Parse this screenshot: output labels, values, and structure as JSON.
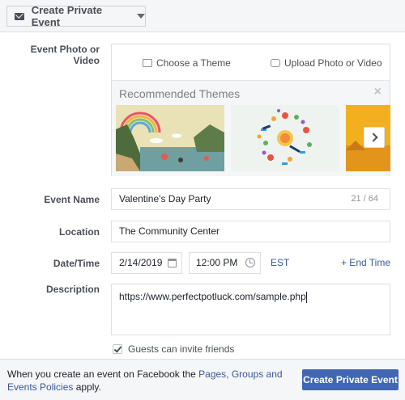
{
  "header": {
    "event_type": "Create Private Event"
  },
  "photo": {
    "label": "Event Photo or Video",
    "choose_theme": "Choose a Theme",
    "upload": "Upload Photo or Video",
    "recommended_title": "Recommended Themes",
    "close_glyph": "×"
  },
  "event_name": {
    "label": "Event Name",
    "value": "Valentine's Day Party",
    "counter": "21 / 64"
  },
  "location": {
    "label": "Location",
    "value": "The Community Center"
  },
  "datetime": {
    "label": "Date/Time",
    "date": "2/14/2019",
    "time": "12:00 PM",
    "timezone": "EST",
    "end_time": "+ End Time"
  },
  "description": {
    "label": "Description",
    "value": "https://www.perfectpotluck.com/sample.php"
  },
  "guests": {
    "label": "Guests can invite friends",
    "checked": true
  },
  "footer": {
    "text_before": "When you create an event on Facebook the ",
    "policy_link": "Pages, Groups and Events Policies",
    "text_after": " apply.",
    "create_button": "Create Private Event"
  },
  "colors": {
    "accent": "#4267b2",
    "link": "#365899"
  },
  "icons": [
    "envelope-icon",
    "caret-down-icon",
    "theme-icon",
    "camera-icon",
    "close-icon",
    "chevron-right-icon",
    "calendar-icon",
    "clock-icon",
    "checkbox-icon"
  ]
}
